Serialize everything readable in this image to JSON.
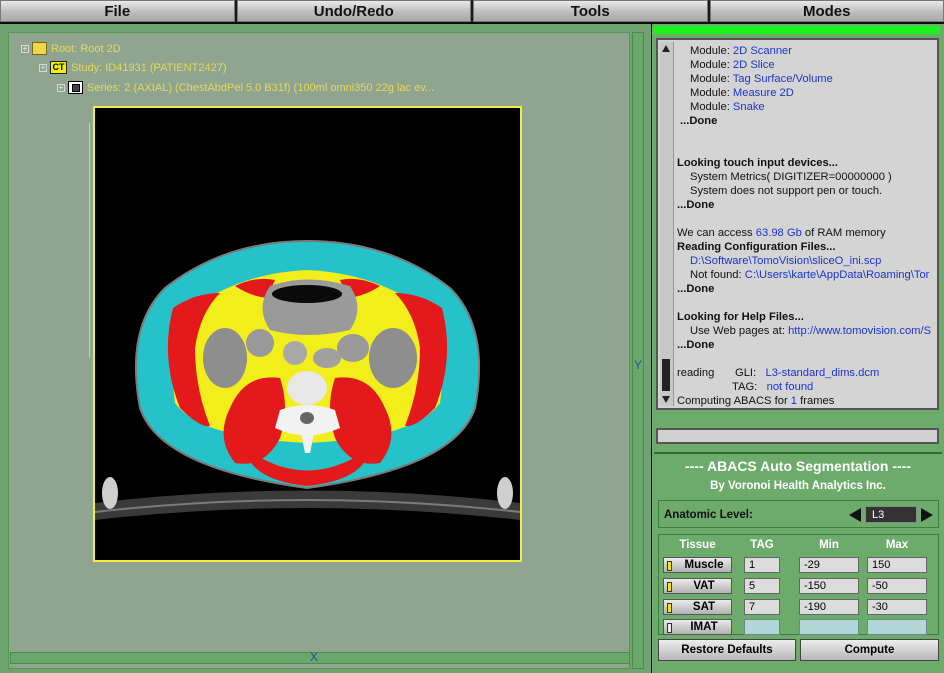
{
  "menu": [
    "File",
    "Undo/Redo",
    "Tools",
    "Modes"
  ],
  "tree": {
    "root": "Root: Root 2D",
    "study": "Study: ID41931 (PATIENT2427)",
    "study_badge": "CT",
    "series": "Series: 2 (AXIAL) (ChestAbdPel  5.0  B31f) (100ml omni350 22g lac ev..."
  },
  "axis": {
    "x": "X",
    "y": "Y"
  },
  "log": {
    "modules_prefix": "Module:",
    "modules": [
      "2D Scanner",
      "2D Slice",
      "Tag Surface/Volume",
      "Measure 2D",
      "Snake"
    ],
    "done": "...Done",
    "touch_header": "Looking touch input devices...",
    "touch_line1": "System Metrics( DIGITIZER=00000000 )",
    "touch_line2": "System does not support pen or touch.",
    "ram_prefix": "We can access",
    "ram_value": "63.98 Gb",
    "ram_suffix": "of RAM memory",
    "config_header": "Reading Configuration Files...",
    "config_path": "D:\\Software\\TomoVision\\sliceO_ini.scp",
    "notfound_prefix": "Not found:",
    "notfound_path": "C:\\Users\\karte\\AppData\\Roaming\\Tor",
    "help_header": "Looking for Help Files...",
    "help_prefix": "Use Web pages at:",
    "help_url": "http://www.tomovision.com/S",
    "reading": "reading",
    "gli_label": "GLI:",
    "gli_value": "L3-standard_dims.dcm",
    "tag_label": "TAG:",
    "tag_value": "not found",
    "computing_prefix": "Computing ABACS for",
    "computing_count": "1",
    "computing_suffix": "frames"
  },
  "abacs": {
    "title": "---- ABACS Auto Segmentation ----",
    "subtitle": "By Voronoi Health Analytics Inc.",
    "anatomic_label": "Anatomic Level:",
    "anatomic_value": "L3",
    "headers": {
      "tissue": "Tissue",
      "tag": "TAG",
      "min": "Min",
      "max": "Max"
    },
    "rows": [
      {
        "name": "Muscle",
        "tag": "1",
        "min": "-29",
        "max": "150",
        "active": true
      },
      {
        "name": "VAT",
        "tag": "5",
        "min": "-150",
        "max": "-50",
        "active": true
      },
      {
        "name": "SAT",
        "tag": "7",
        "min": "-190",
        "max": "-30",
        "active": true
      },
      {
        "name": "IMAT",
        "tag": "",
        "min": "",
        "max": "",
        "active": false
      }
    ],
    "restore_label": "Restore Defaults",
    "compute_label": "Compute"
  },
  "colors": {
    "muscle": "#e4191b",
    "vat": "#f2ee1b",
    "sat": "#25c3c9",
    "frame": "#f3ee3a",
    "link": "#1a35d0"
  }
}
